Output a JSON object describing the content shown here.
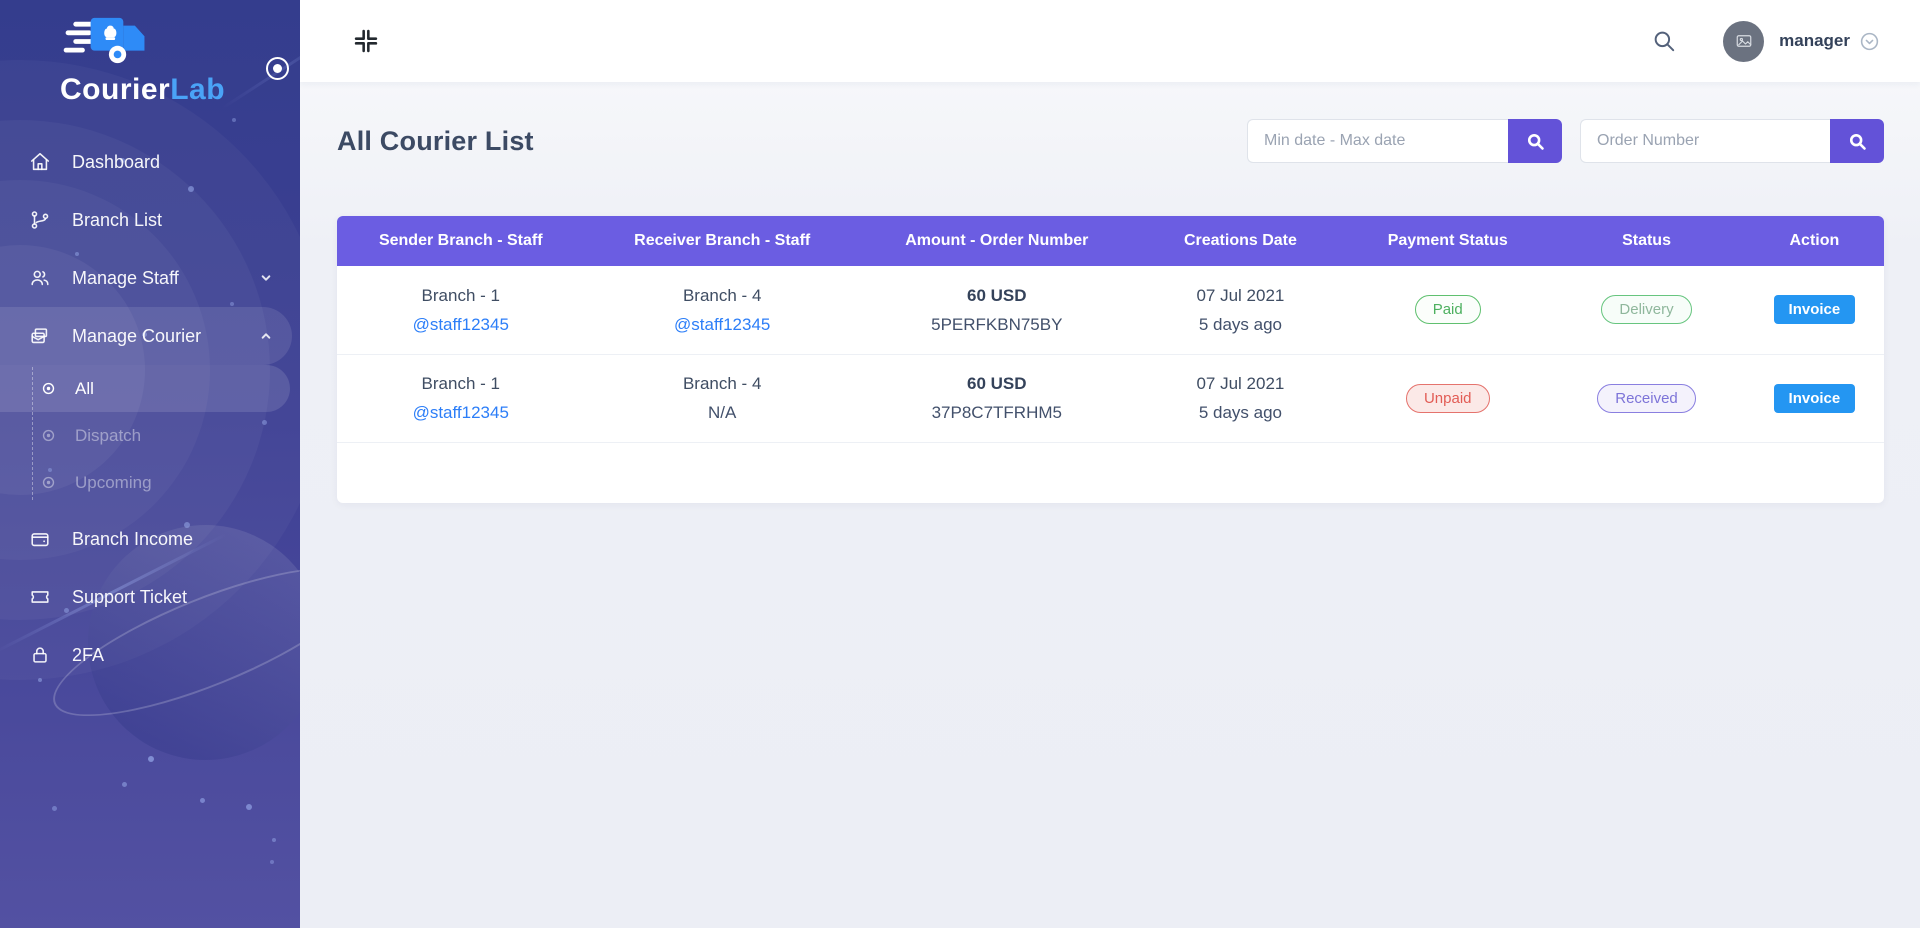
{
  "brand": {
    "primary": "Courier",
    "accent": "Lab"
  },
  "sidebar": {
    "items": [
      {
        "label": "Dashboard",
        "icon": "home-icon"
      },
      {
        "label": "Branch List",
        "icon": "branch-icon"
      },
      {
        "label": "Manage Staff",
        "icon": "staff-icon",
        "chevron": "down"
      },
      {
        "label": "Manage Courier",
        "icon": "courier-icon",
        "chevron": "up",
        "active": true,
        "children": [
          {
            "label": "All",
            "active": true
          },
          {
            "label": "Dispatch",
            "active": false
          },
          {
            "label": "Upcoming",
            "active": false
          }
        ]
      },
      {
        "label": "Branch Income",
        "icon": "wallet-icon"
      },
      {
        "label": "Support Ticket",
        "icon": "ticket-icon"
      },
      {
        "label": "2FA",
        "icon": "lock-icon"
      }
    ]
  },
  "header": {
    "user_name": "manager"
  },
  "page": {
    "title": "All Courier List"
  },
  "filters": {
    "date_placeholder": "Min date - Max date",
    "order_placeholder": "Order Number"
  },
  "table": {
    "columns": [
      "Sender Branch - Staff",
      "Receiver Branch - Staff",
      "Amount - Order Number",
      "Creations Date",
      "Payment Status",
      "Status",
      "Action"
    ],
    "rows": [
      {
        "sender_branch": "Branch - 1",
        "sender_staff": "@staff12345",
        "receiver_branch": "Branch - 4",
        "receiver_staff": "@staff12345",
        "amount": "60 USD",
        "order_number": "5PERFKBN75BY",
        "date": "07 Jul 2021",
        "date_relative": "5 days ago",
        "payment_status": "Paid",
        "status": "Delivery",
        "action": "Invoice"
      },
      {
        "sender_branch": "Branch - 1",
        "sender_staff": "@staff12345",
        "receiver_branch": "Branch - 4",
        "receiver_staff": "N/A",
        "amount": "60 USD",
        "order_number": "37P8C7TFRHM5",
        "date": "07 Jul 2021",
        "date_relative": "5 days ago",
        "payment_status": "Unpaid",
        "status": "Received",
        "action": "Invoice"
      }
    ]
  },
  "colors": {
    "sidebar_top": "#343d8d",
    "sidebar_bottom": "#5351a2",
    "table_header": "#6b5de2",
    "filter_button": "#6352d8",
    "invoice_button": "#2496f2",
    "link": "#2c7ef8",
    "paid": "#4db05f",
    "unpaid": "#e25c55",
    "delivery_border": "#67c57f",
    "received": "#7d74d8",
    "logo_accent": "#4aa3f7"
  }
}
